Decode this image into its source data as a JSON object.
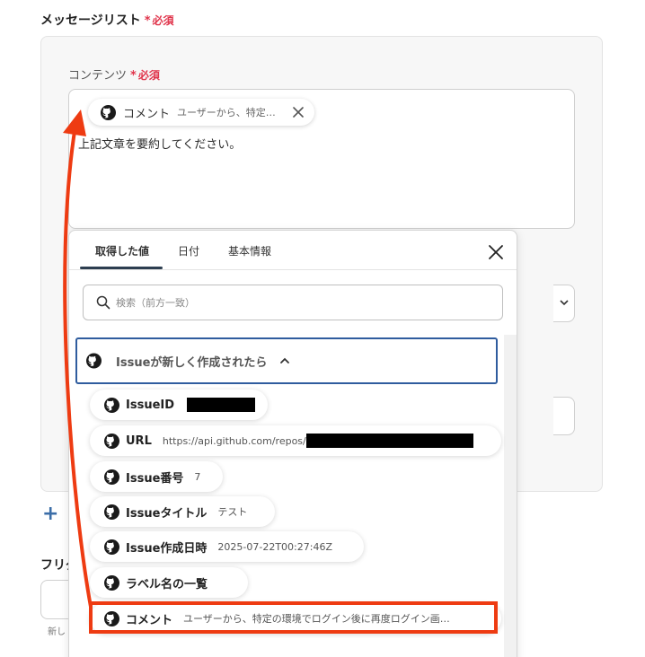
{
  "section": {
    "title": "メッセージリスト",
    "required_star": "*",
    "required_text": "必須"
  },
  "content_field": {
    "label": "コンテンツ",
    "required_star": "*",
    "required_text": "必須",
    "inserted_chip": {
      "label": "コメント",
      "value": "ユーザーから、特定…"
    },
    "body_text": "上記文章を要約してください。"
  },
  "flag_section": {
    "label": "フリグ",
    "hint": "新し"
  },
  "add_icon": "+",
  "dropdown": {
    "tabs": [
      {
        "label": "取得した値",
        "active": true
      },
      {
        "label": "日付",
        "active": false
      },
      {
        "label": "基本情報",
        "active": false
      }
    ],
    "search_placeholder": "検索（前方一致）",
    "group": {
      "title": "Issueが新しく作成されたら",
      "expanded": true
    },
    "items": [
      {
        "label": "IssueID",
        "value": ""
      },
      {
        "label": "URL",
        "value": "https://api.github.com/repos/"
      },
      {
        "label": "Issue番号",
        "value": "7"
      },
      {
        "label": "Issueタイトル",
        "value": "テスト"
      },
      {
        "label": "Issue作成日時",
        "value": "2025-07-22T00:27:46Z"
      },
      {
        "label": "ラベル名の一覧",
        "value": ""
      },
      {
        "label": "コメント",
        "value": "ユーザーから、特定の環境でログイン後に再度ログイン画…"
      }
    ]
  },
  "colors": {
    "annotation": "#ee3b12",
    "group_border": "#2f5c9e",
    "required": "#e0344b"
  },
  "icons": {
    "chip_icon": "github-icon",
    "close": "close-icon",
    "search": "search-icon",
    "chevron": "chevron-up-icon",
    "add": "plus-icon"
  }
}
